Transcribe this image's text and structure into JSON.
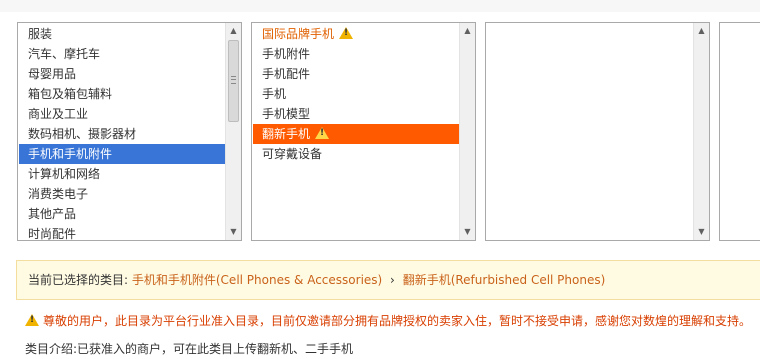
{
  "category_list_1": {
    "items": [
      "服装",
      "汽车、摩托车",
      "母婴用品",
      "箱包及箱包辅料",
      "商业及工业",
      "数码相机、摄影器材",
      "手机和手机附件",
      "计算机和网络",
      "消费类电子",
      "其他产品",
      "时尚配件"
    ],
    "selected": "手机和手机附件"
  },
  "category_list_2": {
    "items": [
      "国际品牌手机",
      "手机附件",
      "手机配件",
      "手机",
      "手机模型",
      "翻新手机",
      "可穿戴设备"
    ],
    "selected": "翻新手机",
    "warning_items": [
      "国际品牌手机",
      "翻新手机"
    ]
  },
  "category_list_3": {
    "items": []
  },
  "current_selection": {
    "label": "当前已选择的类目:",
    "level1": "手机和手机附件(Cell Phones & Accessories)",
    "separator": "›",
    "level2": "翻新手机(Refurbished Cell Phones)"
  },
  "notice": {
    "text": "尊敬的用户，此目录为平台行业准入目录，目前仅邀请部分拥有品牌授权的卖家入住，暂时不接受申请，感谢您对数煌的理解和支持。"
  },
  "intro": {
    "label": "类目介绍:",
    "text": "已获准入的商户，可在此类目上传翻新机、二手手机"
  },
  "colors": {
    "selected_blue": "#3875d7",
    "selected_orange": "#ff5a00",
    "notice_red": "#d83e00",
    "selection_value": "#c9621a",
    "warning_yellow": "#f0b400"
  }
}
